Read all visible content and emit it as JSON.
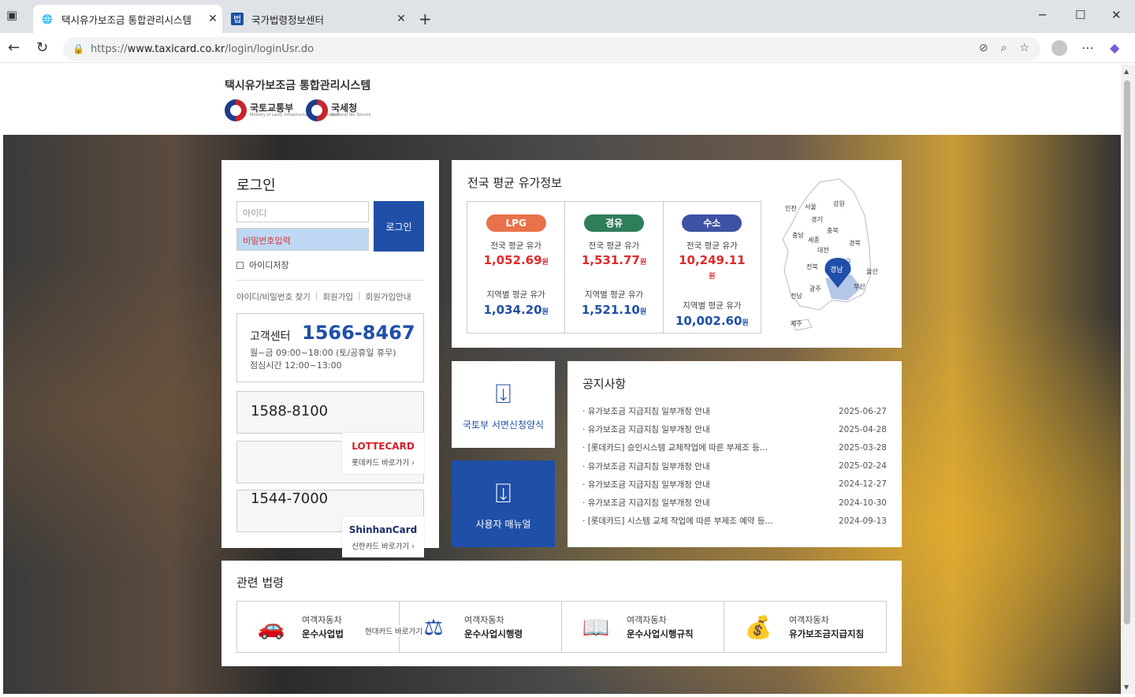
{
  "browser": {
    "tabs": [
      {
        "label": "택시유가보조금 통합관리시스템"
      },
      {
        "label": "국가법령정보센터",
        "icon_text": "법"
      }
    ],
    "url_scheme": "https://",
    "url_host": "www.taxicard.co.kr",
    "url_path": "/login/loginUsr.do"
  },
  "header": {
    "site_title": "택시유가보조금 통합관리시스템",
    "org1": "국토교통부",
    "org1_sub": "Ministry of Land, Infrastructure and Transport",
    "org2": "국세청",
    "org2_sub": "National Tax Service"
  },
  "login": {
    "title": "로그인",
    "id_placeholder": "아이디",
    "pw_placeholder": "비밀번호입력",
    "button": "로그인",
    "save_id": "아이디저장",
    "links": [
      "아이디/비밀번호 찾기",
      "회원가입",
      "회원가입안내"
    ],
    "cs_label": "고객센터",
    "cs_number": "1566-8467",
    "cs_hours": "월~금 09:00~18:00 (토/공휴일 휴무)",
    "cs_lunch": "점심시간 12:00~13:00",
    "cards": [
      {
        "number": "1588-8100",
        "brand": "",
        "go": ""
      },
      {
        "number": "",
        "brand": "LOTTECARD",
        "go": "롯데카드 바로가기 ›"
      },
      {
        "number": "1544-7000",
        "brand": "ShinhanCard",
        "go": "신한카드 바로가기 ›"
      }
    ]
  },
  "fuel": {
    "title": "전국 평균 유가정보",
    "national_label": "전국 평균 유가",
    "regional_label": "지역별 평균 유가",
    "unit": "원",
    "items": [
      {
        "name": "LPG",
        "color": "#e8734a",
        "national": "1,052.69",
        "regional": "1,034.20",
        "national_color": "#e0292a"
      },
      {
        "name": "경유",
        "color": "#2e7d5b",
        "national": "1,531.77",
        "regional": "1,521.10",
        "national_color": "#e0292a"
      },
      {
        "name": "수소",
        "color": "#3f51a5",
        "national": "10,249.11",
        "regional": "10,002.60",
        "national_color": "#e0292a"
      }
    ],
    "regions": [
      "인천",
      "서울",
      "강원",
      "경기",
      "충북",
      "충남",
      "세종",
      "경북",
      "대전",
      "전북",
      "대구",
      "울산",
      "광주",
      "부산",
      "전남",
      "제주"
    ],
    "selected_region": "경남"
  },
  "quick": {
    "form_label": "국토부 서면신청양식",
    "manual_label": "사용자 매뉴얼"
  },
  "notice": {
    "title": "공지사항",
    "items": [
      {
        "title": "유가보조금 지급지침 일부개정 안내",
        "date": "2025-06-27"
      },
      {
        "title": "유가보조금 지급지침 일부개정 안내",
        "date": "2025-04-28"
      },
      {
        "title": "[롯데카드] 승인시스템 교체작업에 따른 부제조 등…",
        "date": "2025-03-28"
      },
      {
        "title": "유가보조금 지급지침 일부개정 안내",
        "date": "2025-02-24"
      },
      {
        "title": "유가보조금 지급지침 일부개정 안내",
        "date": "2024-12-27"
      },
      {
        "title": "유가보조금 지급지침 일부개정 안내",
        "date": "2024-10-30"
      },
      {
        "title": "[롯데카드] 시스템 교체 작업에 따른 부제조 예약 등…",
        "date": "2024-09-13"
      }
    ]
  },
  "laws": {
    "title": "관련 법령",
    "hyundai_go": "현대카드 바로가기 ›",
    "items": [
      {
        "l1": "여객자동차",
        "l2": "운수사업법",
        "icon": "car-icon"
      },
      {
        "l1": "여객자동차",
        "l2": "운수사업시행령",
        "icon": "gavel-icon"
      },
      {
        "l1": "여객자동차",
        "l2": "운수사업시행규칙",
        "icon": "book-icon"
      },
      {
        "l1": "여객자동차",
        "l2": "유가보조금지급지침",
        "icon": "money-hand-icon"
      }
    ]
  }
}
